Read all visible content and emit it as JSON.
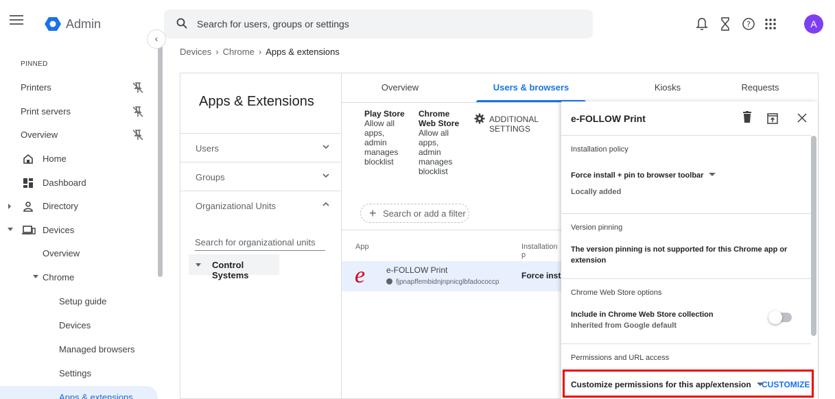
{
  "app": {
    "title": "Admin",
    "avatar_letter": "A"
  },
  "search": {
    "placeholder": "Search for users, groups or settings"
  },
  "sidebar": {
    "pinned_header": "PINNED",
    "pinned": [
      "Printers",
      "Print servers",
      "Overview"
    ],
    "items": {
      "home": "Home",
      "dashboard": "Dashboard",
      "directory": "Directory",
      "devices": "Devices",
      "overview": "Overview",
      "chrome": "Chrome",
      "setup_guide": "Setup guide",
      "devices_sub": "Devices",
      "managed_browsers": "Managed browsers",
      "settings": "Settings",
      "apps_extensions": "Apps & extensions"
    }
  },
  "breadcrumb": [
    "Devices",
    "Chrome",
    "Apps & extensions"
  ],
  "left_card": {
    "title": "Apps & Extensions",
    "filters": [
      "Users",
      "Groups",
      "Organizational Units"
    ],
    "ou_search_placeholder": "Search for organizational units",
    "ou_node": "Control Systems"
  },
  "tabs": [
    "Overview",
    "Users & browsers",
    "Kiosks",
    "Requests"
  ],
  "store_settings": {
    "play_store": {
      "title": "Play Store",
      "lines": [
        "Allow all",
        "apps,",
        "admin",
        "manages",
        "blocklist"
      ]
    },
    "chrome_store": {
      "title_1": "Chrome",
      "title_2": "Web Store",
      "lines": [
        "Allow all",
        "apps,",
        "admin",
        "manages",
        "blocklist"
      ]
    },
    "additional_1": "ADDITIONAL",
    "additional_2": "SETTINGS"
  },
  "filter_chip": "Search or add a filter",
  "table": {
    "col_app": "App",
    "col_policy": "Installation p",
    "rows": [
      {
        "name": "e-FOLLOW Print",
        "id": "fjpnapffembidnjnpnicglbfadococcp",
        "policy": "Force insta"
      }
    ]
  },
  "detail": {
    "title": "e-FOLLOW Print",
    "install_policy_header": "Installation policy",
    "install_policy_value": "Force install + pin to browser toolbar",
    "install_policy_sub": "Locally added",
    "version_header": "Version pinning",
    "version_text_1": "The version pinning is not supported for this Chrome app or",
    "version_text_2": "extension",
    "cws_header": "Chrome Web Store options",
    "cws_value": "Include in Chrome Web Store collection",
    "cws_sub": "Inherited from Google default",
    "cws_toggle_on": false,
    "perm_header": "Permissions and URL access",
    "perm_value": "Customize permissions for this app/extension",
    "customize_label": "CUSTOMIZE"
  },
  "colors": {
    "accent": "#1a73e8",
    "highlight": "#ee0000",
    "avatar": "#7e3ff2"
  }
}
